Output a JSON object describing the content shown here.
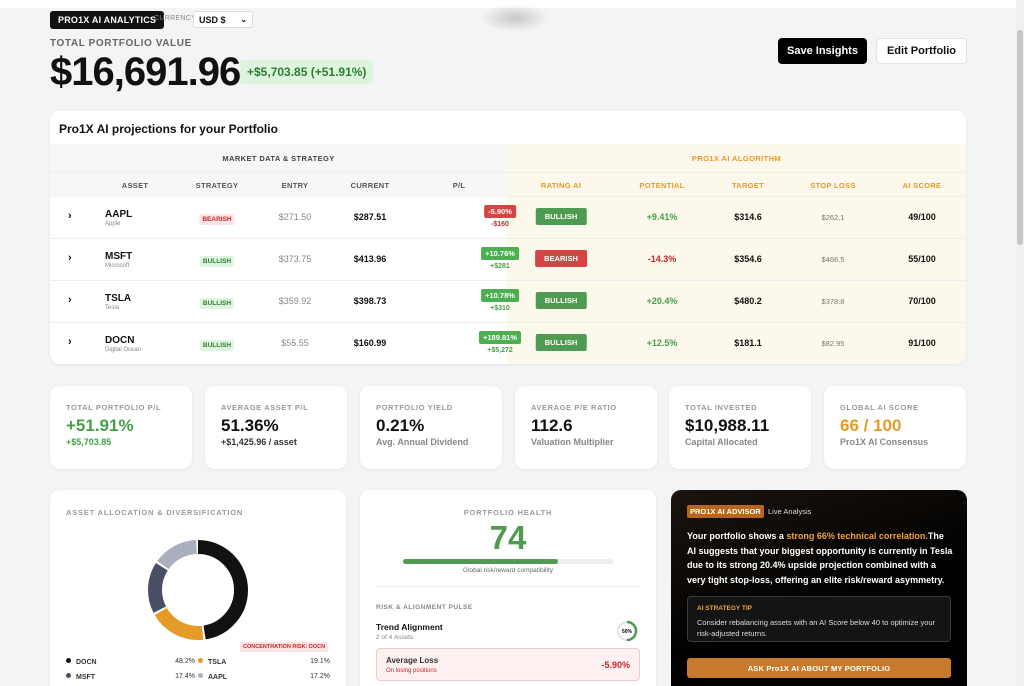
{
  "header": {
    "brand": "PRO1X AI ANALYTICS",
    "currency_label": "CURRENCY:",
    "currency_value": "USD $"
  },
  "portfolio": {
    "label": "TOTAL PORTFOLIO VALUE",
    "value": "$16,691.96",
    "change": "+$5,703.85 (+51.91%)"
  },
  "actions": {
    "save": "Save Insights",
    "edit": "Edit Portfolio"
  },
  "projections": {
    "title": "Pro1X AI projections for your Portfolio",
    "group_market": "MARKET DATA & STRATEGY",
    "group_algo": "PRO1X AI ALGORITHM",
    "columns": [
      "ASSET",
      "STRATEGY",
      "ENTRY",
      "CURRENT",
      "P/L",
      "RATING AI",
      "POTENTIAL",
      "TARGET",
      "STOP LOSS",
      "AI SCORE"
    ],
    "rows": [
      {
        "ticker": "AAPL",
        "name": "Apple",
        "strategy": "BEARISH",
        "entry": "$271.50",
        "current": "$287.51",
        "pl_pct": "-5.90%",
        "pl_abs": "-$160",
        "rating": "BULLISH",
        "potential": "+9.41%",
        "target": "$314.6",
        "stop": "$262.1",
        "score": "49/100"
      },
      {
        "ticker": "MSFT",
        "name": "Microsoft",
        "strategy": "BULLISH",
        "entry": "$373.75",
        "current": "$413.96",
        "pl_pct": "+10.76%",
        "pl_abs": "+$281",
        "rating": "BEARISH",
        "potential": "-14.3%",
        "target": "$354.6",
        "stop": "$466.5",
        "score": "55/100"
      },
      {
        "ticker": "TSLA",
        "name": "Tesla",
        "strategy": "BULLISH",
        "entry": "$359.92",
        "current": "$398.73",
        "pl_pct": "+10.78%",
        "pl_abs": "+$310",
        "rating": "BULLISH",
        "potential": "+20.4%",
        "target": "$480.2",
        "stop": "$378.8",
        "score": "70/100"
      },
      {
        "ticker": "DOCN",
        "name": "Digital Ocean",
        "strategy": "BULLISH",
        "entry": "$55.55",
        "current": "$160.99",
        "pl_pct": "+189.81%",
        "pl_abs": "+$5,272",
        "rating": "BULLISH",
        "potential": "+12.5%",
        "target": "$181.1",
        "stop": "$82.95",
        "score": "91/100"
      }
    ]
  },
  "stats": [
    {
      "label": "TOTAL PORTFOLIO P/L",
      "value": "+51.91%",
      "sub": "+$5,703.85"
    },
    {
      "label": "AVERAGE ASSET P/L",
      "value": "51.36%",
      "sub": "+$1,425.96 / asset"
    },
    {
      "label": "PORTFOLIO YIELD",
      "value": "0.21%",
      "sub": "Avg. Annual Dividend"
    },
    {
      "label": "AVERAGE P/E RATIO",
      "value": "112.6",
      "sub": "Valuation Multiplier"
    },
    {
      "label": "TOTAL INVESTED",
      "value": "$10,988.11",
      "sub": "Capital Allocated"
    },
    {
      "label": "GLOBAL AI SCORE",
      "value": "66 / 100",
      "sub": "Pro1X AI Consensus"
    }
  ],
  "allocation": {
    "title": "ASSET ALLOCATION & DIVERSIFICATION",
    "badge": "CONCENTRATION RISK: DOCN",
    "items": [
      {
        "name": "DOCN",
        "value": "48.2%",
        "fraction": 0.482,
        "color": "#111111"
      },
      {
        "name": "TSLA",
        "value": "19.1%",
        "fraction": 0.191,
        "color": "#e69a27"
      },
      {
        "name": "MSFT",
        "value": "17.4%",
        "fraction": 0.174,
        "color": "#4a4f63"
      },
      {
        "name": "AAPL",
        "value": "17.2%",
        "fraction": 0.153,
        "color": "#a9afbd"
      }
    ]
  },
  "health": {
    "title": "PORTFOLIO HEALTH",
    "value": "74",
    "level": 0.74,
    "sub": "Global risk/reward compatibility",
    "pulse_title": "RISK & ALIGNMENT PULSE",
    "trend_label": "Trend Alignment",
    "trend_sub": "2 of 4 Assets",
    "trend_pct": "50%",
    "trend_level": 0.5,
    "loss_label": "Average Loss",
    "loss_sub": "On losing positions",
    "loss_value": "-5.90%"
  },
  "advisor": {
    "tag": "PRO1X AI ADVISOR",
    "live": "Live Analysis",
    "t1": "Your portfolio shows a ",
    "t2": "strong 66% technical correlation.",
    "t3": "The AI suggests that your biggest opportunity is currently in ",
    "t4": "Tesla",
    "t5": " due to its strong 20.4% upside projection combined with a very tight stop-loss, offering an elite risk/reward asymmetry.",
    "tip_title": "AI STRATEGY TIP",
    "tip_text": "Consider rebalancing assets with an AI Score below 40 to optimize your risk-adjusted returns.",
    "ask": "ASK Pro1X AI ABOUT MY PORTFOLIO"
  },
  "colors": {
    "bull": "#4f9b52",
    "bear": "#d64545",
    "accent": "#e69a27"
  }
}
